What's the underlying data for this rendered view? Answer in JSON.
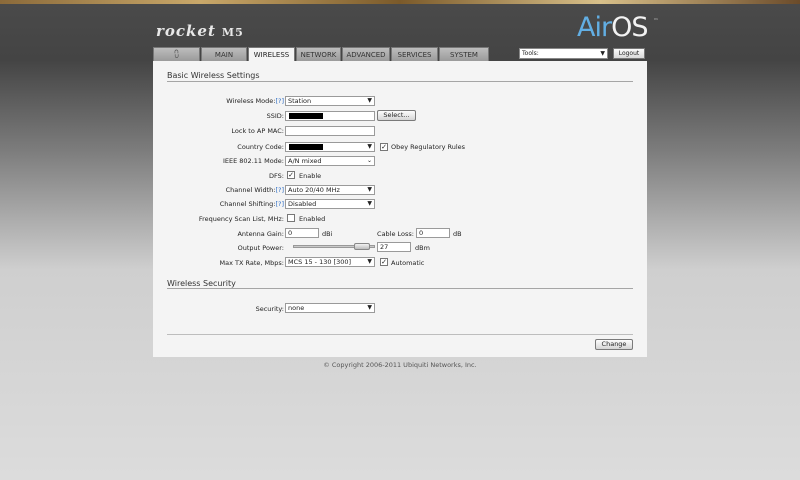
{
  "brand": {
    "name": "rocket",
    "model": "M5"
  },
  "logo": {
    "air": "Air",
    "os": "OS",
    "tm": "™"
  },
  "tabs": [
    {
      "label": "⩇"
    },
    {
      "label": "MAIN"
    },
    {
      "label": "WIRELESS"
    },
    {
      "label": "NETWORK"
    },
    {
      "label": "ADVANCED"
    },
    {
      "label": "SERVICES"
    },
    {
      "label": "SYSTEM"
    }
  ],
  "header": {
    "tools_value": "Tools:",
    "logout_label": "Logout"
  },
  "basic": {
    "title": "Basic Wireless Settings",
    "wireless_mode": {
      "label": "Wireless Mode:",
      "help": "[?]",
      "value": "Station"
    },
    "ssid": {
      "label": "SSID:",
      "select_label": "Select..."
    },
    "lock_ap": {
      "label": "Lock to AP MAC:",
      "value": ""
    },
    "country": {
      "label": "Country Code:",
      "obey_label": "Obey Regulatory Rules",
      "obey_checked": "✓"
    },
    "ieee": {
      "label": "IEEE 802.11 Mode:",
      "value": "A/N mixed"
    },
    "dfs": {
      "label": "DFS:",
      "enable_label": "Enable",
      "checked": "✓"
    },
    "channel_width": {
      "label": "Channel Width:",
      "help": "[?]",
      "value": "Auto 20/40 MHz"
    },
    "channel_shifting": {
      "label": "Channel Shifting:",
      "help": "[?]",
      "value": "Disabled"
    },
    "freq_scan": {
      "label": "Frequency Scan List, MHz:",
      "enabled_label": "Enabled"
    },
    "antenna_gain": {
      "label": "Antenna Gain:",
      "value": "0",
      "unit": "dBi"
    },
    "cable_loss": {
      "label": "Cable Loss:",
      "value": "0",
      "unit": "dB"
    },
    "output_power": {
      "label": "Output Power:",
      "value": "27",
      "unit": "dBm",
      "level": 0.93
    },
    "max_tx": {
      "label": "Max TX Rate, Mbps:",
      "value": "MCS 15 - 130 [300]",
      "auto_label": "Automatic",
      "auto_checked": "✓"
    }
  },
  "security": {
    "title": "Wireless Security",
    "label": "Security:",
    "value": "none"
  },
  "actions": {
    "change_label": "Change"
  },
  "footer": {
    "copyright": "© Copyright 2006-2011 Ubiquiti Networks, Inc."
  },
  "colors": {
    "help_link": "#2b6cc4",
    "airos_blue": "#62aee3"
  }
}
